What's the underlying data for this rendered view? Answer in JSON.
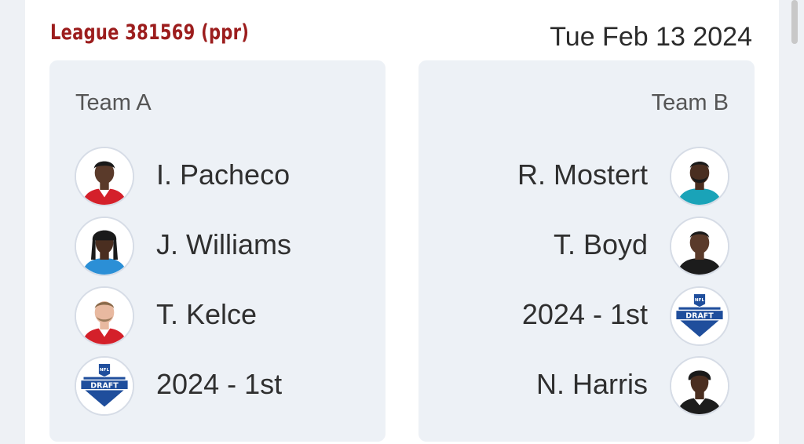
{
  "header": {
    "league": "League 381569 (ppr)",
    "date": "Tue Feb 13 2024"
  },
  "team_a": {
    "title": "Team A",
    "items": [
      {
        "name": "I. Pacheco",
        "icon": "player-avatar-icon"
      },
      {
        "name": "J. Williams",
        "icon": "player-avatar-icon"
      },
      {
        "name": "T. Kelce",
        "icon": "player-avatar-icon"
      },
      {
        "name": "2024 - 1st",
        "icon": "nfl-draft-logo-icon"
      }
    ]
  },
  "team_b": {
    "title": "Team B",
    "items": [
      {
        "name": "R. Mostert",
        "icon": "player-avatar-icon"
      },
      {
        "name": "T. Boyd",
        "icon": "player-avatar-icon"
      },
      {
        "name": "2024 - 1st",
        "icon": "nfl-draft-logo-icon"
      },
      {
        "name": "N. Harris",
        "icon": "player-avatar-icon"
      }
    ]
  },
  "logos": {
    "nfl": "NFL",
    "draft": "DRAFT"
  },
  "colors": {
    "league_title": "#9c1d1d",
    "panel_bg": "#edf1f6",
    "page_bg": "#eef1f5",
    "jersey_red": "#d4202a",
    "jersey_teal": "#1aa3b8",
    "jersey_blue": "#2b8fd6",
    "jersey_black": "#1c1c1c",
    "draft_blue": "#1f4e9c"
  }
}
